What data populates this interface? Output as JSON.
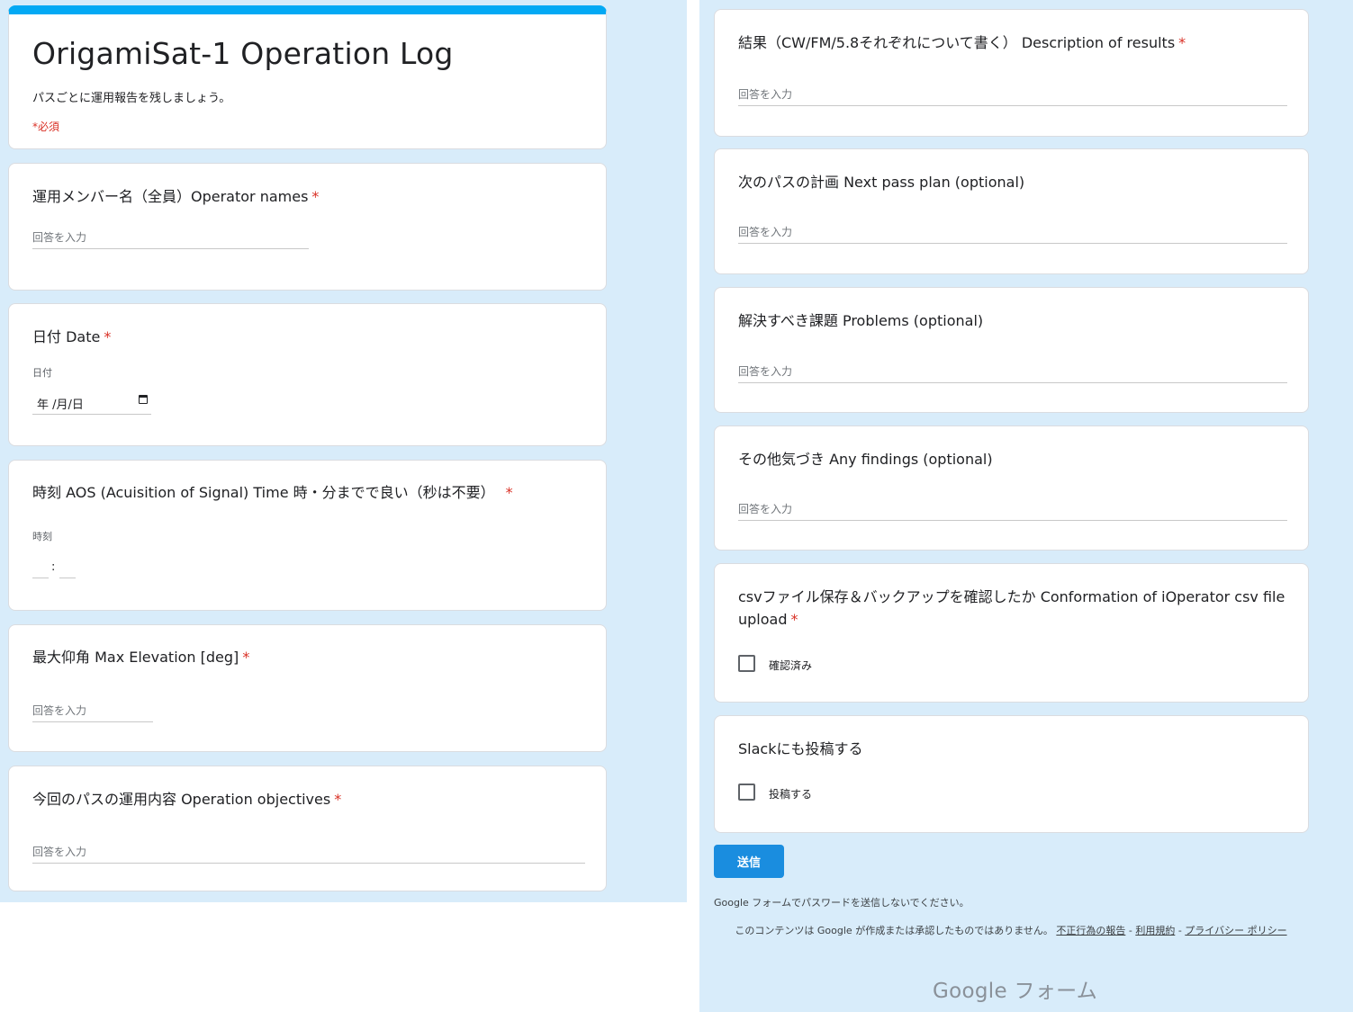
{
  "form": {
    "title": "OrigamiSat-1 Operation Log",
    "description": "パスごとに運用報告を残しましょう。",
    "required_note": "*必須"
  },
  "placeholder": "回答を入力",
  "required_mark": "*",
  "questions": {
    "operator_names": {
      "title": "運用メンバー名（全員）Operator names"
    },
    "date": {
      "title": "日付 Date",
      "sub_label": "日付",
      "value": "年 /月/日"
    },
    "aos_time": {
      "title": "時刻 AOS (Acuisition of Signal) Time 時・分までで良い（秒は不要）",
      "sub_label": "時刻",
      "separator": ":"
    },
    "max_elevation": {
      "title": "最大仰角 Max Elevation [deg]"
    },
    "objectives": {
      "title": "今回のパスの運用内容 Operation objectives"
    },
    "results": {
      "title": "結果（CW/FM/5.8それぞれについて書く） Description of results"
    },
    "next_plan": {
      "title": "次のパスの計画 Next pass plan (optional)"
    },
    "problems": {
      "title": "解決すべき課題 Problems (optional)"
    },
    "findings": {
      "title": "その他気づき Any findings (optional)"
    },
    "csv_confirm": {
      "title": "csvファイル保存＆バックアップを確認したか Conformation of iOperator csv file upload",
      "option": "確認済み",
      "checked": false
    },
    "slack": {
      "title": "Slackにも投稿する",
      "option": "投稿する",
      "checked": false
    }
  },
  "submit_label": "送信",
  "footer": {
    "password_note": "Google フォームでパスワードを送信しないでください。",
    "disclaimer": "このコンテンツは Google が作成または承認したものではありません。",
    "report_link": "不正行為の報告",
    "terms_link": "利用規約",
    "privacy_link": "プライバシー ポリシー",
    "separator": " - ",
    "brand": "Google フォーム"
  },
  "colors": {
    "accent": "#03a9f4",
    "background": "#d8ecfa",
    "required": "#d93025",
    "submit": "#1a8ddf"
  }
}
